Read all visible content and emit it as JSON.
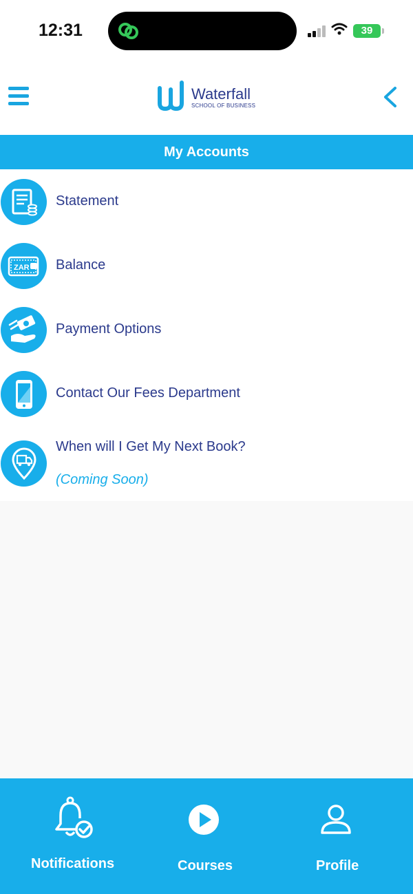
{
  "status_bar": {
    "time": "12:31",
    "battery": "39"
  },
  "header": {
    "logo_name": "Waterfall",
    "logo_subtitle": "SCHOOL OF BUSINESS",
    "menu_icon": "hamburger-icon",
    "back_icon": "chevron-left-icon"
  },
  "page": {
    "title": "My Accounts"
  },
  "menu": {
    "items": [
      {
        "label": "Statement",
        "icon": "statement-icon"
      },
      {
        "label": "Balance",
        "icon": "wallet-icon"
      },
      {
        "label": "Payment Options",
        "icon": "payment-hand-icon"
      },
      {
        "label": "Contact Our Fees Department",
        "icon": "phone-icon"
      },
      {
        "label": "When will I Get My Next Book?",
        "sublabel": "(Coming Soon)",
        "icon": "delivery-pin-icon"
      }
    ]
  },
  "bottom_nav": {
    "items": [
      {
        "label": "Notifications",
        "icon": "bell-check-icon"
      },
      {
        "label": "Courses",
        "icon": "play-circle-icon"
      },
      {
        "label": "Profile",
        "icon": "user-icon"
      }
    ]
  },
  "colors": {
    "accent": "#18aeea",
    "text": "#2b3a8c",
    "background": "#f9f9f9"
  }
}
